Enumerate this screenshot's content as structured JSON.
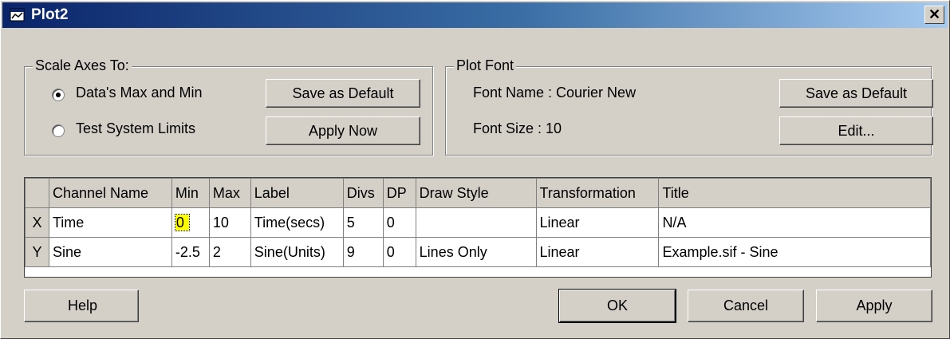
{
  "window": {
    "title": "Plot2",
    "close_symbol": "✕"
  },
  "scale_axes": {
    "legend": "Scale Axes To:",
    "options": [
      {
        "label": "Data's Max and Min",
        "selected": true
      },
      {
        "label": "Test System Limits",
        "selected": false
      }
    ],
    "save_default_label": "Save as Default",
    "apply_now_label": "Apply Now"
  },
  "plot_font": {
    "legend": "Plot Font",
    "font_name_text": "Font Name : Courier New",
    "font_size_text": "Font Size :  10",
    "save_default_label": "Save as Default",
    "edit_label": "Edit..."
  },
  "grid": {
    "columns": [
      "",
      "Channel Name",
      "Min",
      "Max",
      "Label",
      "Divs",
      "DP",
      "Draw Style",
      "Transformation",
      "Title"
    ],
    "rows": [
      [
        "X",
        "Time",
        "0",
        "10",
        "Time(secs)",
        "5",
        "0",
        "",
        "Linear",
        "N/A"
      ],
      [
        "Y",
        "Sine",
        "-2.5",
        "2",
        "Sine(Units)",
        "9",
        "0",
        "Lines Only",
        "Linear",
        "Example.sif - Sine"
      ]
    ]
  },
  "buttons": {
    "help": "Help",
    "ok": "OK",
    "cancel": "Cancel",
    "apply": "Apply"
  },
  "colors": {
    "title_start": "#0a246a",
    "title_end": "#a6caf0",
    "selected_cell": "#ffff00",
    "face": "#d4d0c8"
  }
}
